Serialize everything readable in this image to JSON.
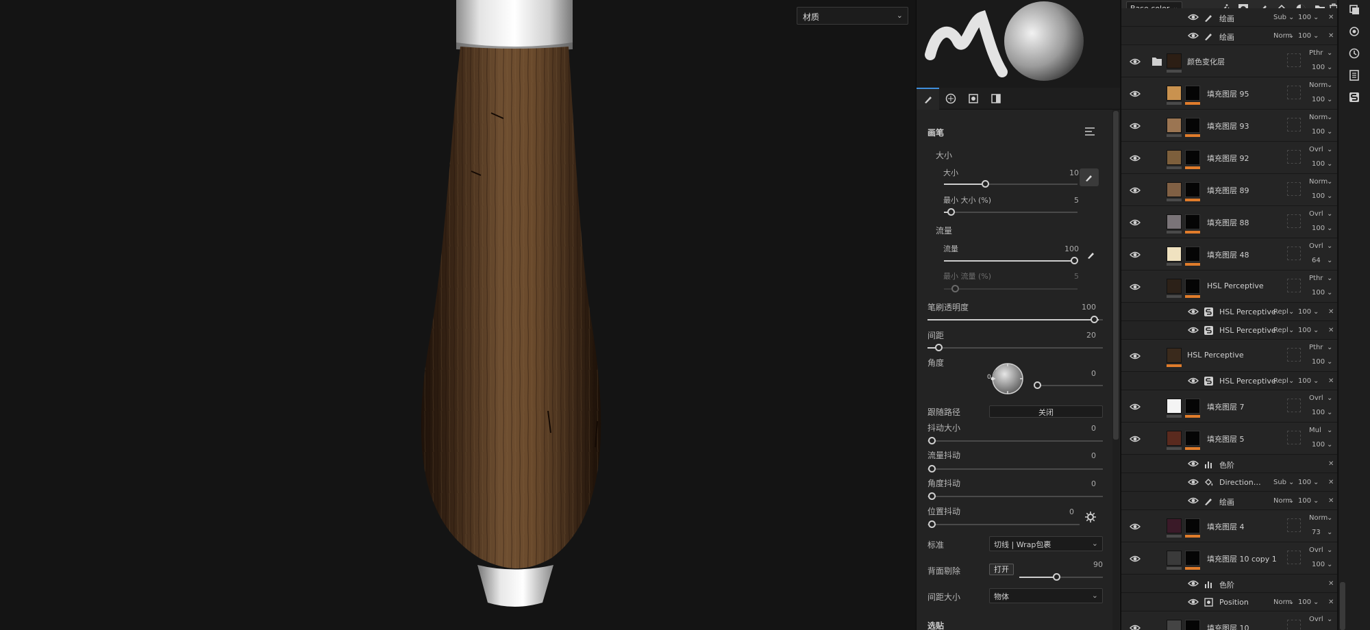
{
  "viewport": {
    "material_select": "材质"
  },
  "brush_panel": {
    "section_title": "画笔",
    "size_group": "大小",
    "size_label": "大小",
    "size_value": "10",
    "min_size_label": "最小 大小 (%)",
    "min_size_value": "5",
    "flow_group": "流量",
    "flow_label": "流量",
    "flow_value": "100",
    "min_flow_label": "最小 流量 (%)",
    "min_flow_value": "5",
    "opacity_label": "笔刷透明度",
    "opacity_value": "100",
    "spacing_label": "间距",
    "spacing_value": "20",
    "angle_label": "角度",
    "angle_dial_value": "0",
    "angle_value": "0",
    "follow_path_label": "跟随路径",
    "follow_path_value": "关闭",
    "size_jitter_label": "抖动大小",
    "size_jitter_value": "0",
    "flow_jitter_label": "流量抖动",
    "flow_jitter_value": "0",
    "angle_jitter_label": "角度抖动",
    "angle_jitter_value": "0",
    "position_jitter_label": "位置抖动",
    "position_jitter_value": "0",
    "alignment_label": "标准",
    "alignment_value": "切线 | Wrap包裹",
    "backface_label": "背面剔除",
    "backface_toggle": "打开",
    "backface_value": "90",
    "spacing_size_label": "间距大小",
    "spacing_size_value": "物体",
    "bottom_label": "选贴"
  },
  "layers_panel": {
    "channel": "Base color",
    "rows": [
      {
        "type": "sub",
        "name": "绘画",
        "blend": "Sub",
        "opacity": "100",
        "icon": "brush-icon"
      },
      {
        "type": "sub",
        "name": "绘画",
        "blend": "Norm",
        "opacity": "100",
        "icon": "brush-icon"
      },
      {
        "type": "folder",
        "name": "颜色变化层",
        "blend": "Pthr",
        "opacity": "100"
      },
      {
        "type": "fill",
        "name": "填充图层 95",
        "blend": "Norm",
        "opacity": "100",
        "color": "#c9924f"
      },
      {
        "type": "fill",
        "name": "填充图层 93",
        "blend": "Norm",
        "opacity": "100",
        "color": "#9b7552"
      },
      {
        "type": "fill",
        "name": "填充图层 92",
        "blend": "Ovrl",
        "opacity": "100",
        "color": "#7d5f3c"
      },
      {
        "type": "fill",
        "name": "填充图层 89",
        "blend": "Norm",
        "opacity": "100",
        "color": "#806044"
      },
      {
        "type": "fill",
        "name": "填充图层 88",
        "blend": "Ovrl",
        "opacity": "100",
        "color": "#7a7478"
      },
      {
        "type": "fill",
        "name": "填充图层 48",
        "blend": "Ovrl",
        "opacity": "64",
        "color": "#f0e2c0"
      },
      {
        "type": "fill",
        "name": "HSL Perceptive",
        "blend": "Pthr",
        "opacity": "100",
        "color": "#2c2118"
      },
      {
        "type": "sub",
        "name": "HSL Perceptive",
        "blend": "Repl",
        "opacity": "100",
        "icon": "filter-icon"
      },
      {
        "type": "sub",
        "name": "HSL Perceptive",
        "blend": "Repl",
        "opacity": "100",
        "icon": "filter-icon"
      },
      {
        "type": "fill",
        "name": "HSL Perceptive",
        "blend": "Pthr",
        "opacity": "100",
        "color": "#3a2a1c"
      },
      {
        "type": "sub",
        "name": "HSL Perceptive",
        "blend": "Repl",
        "opacity": "100",
        "icon": "filter-icon"
      },
      {
        "type": "fill",
        "name": "填充图层 7",
        "blend": "Ovrl",
        "opacity": "100",
        "color": "#f4f4f4"
      },
      {
        "type": "fill",
        "name": "填充图层 5",
        "blend": "Mul",
        "opacity": "100",
        "color": "#5a2a1e"
      },
      {
        "type": "sub",
        "name": "色阶",
        "blend": "",
        "opacity": "",
        "icon": "levels-icon"
      },
      {
        "type": "sub",
        "name": "Direction…",
        "blend": "Sub",
        "opacity": "100",
        "icon": "fill-icon"
      },
      {
        "type": "sub",
        "name": "绘画",
        "blend": "Norm",
        "opacity": "100",
        "icon": "brush-icon"
      },
      {
        "type": "fill",
        "name": "填充图层 4",
        "blend": "Norm",
        "opacity": "73",
        "color": "#3a1a28"
      },
      {
        "type": "fill",
        "name": "填充图层 10 copy 1",
        "blend": "Ovrl",
        "opacity": "100",
        "color": "#3a3a3a"
      },
      {
        "type": "sub",
        "name": "色阶",
        "blend": "",
        "opacity": "",
        "icon": "levels-icon"
      },
      {
        "type": "sub",
        "name": "Position",
        "blend": "Norm",
        "opacity": "100",
        "icon": "generator-icon"
      },
      {
        "type": "fill",
        "name": "填充图层 10",
        "blend": "Ovrl",
        "opacity": "",
        "color": "#444444"
      }
    ]
  }
}
